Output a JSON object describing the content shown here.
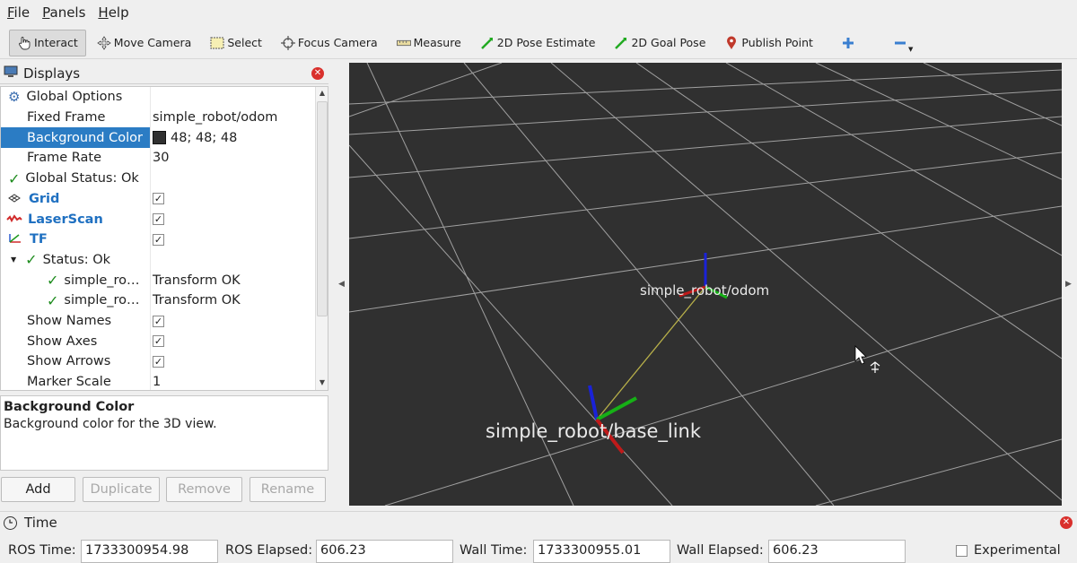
{
  "menu": [
    {
      "key": "F",
      "rest": "ile"
    },
    {
      "key": "P",
      "rest": "anels"
    },
    {
      "key": "H",
      "rest": "elp"
    }
  ],
  "toolbar": {
    "interact": "Interact",
    "move_camera": "Move Camera",
    "select": "Select",
    "focus_camera": "Focus Camera",
    "measure": "Measure",
    "pose_estimate": "2D Pose Estimate",
    "goal_pose": "2D Goal Pose",
    "publish_point": "Publish Point"
  },
  "displays": {
    "title": "Displays",
    "rows": {
      "global_options": "Global Options",
      "fixed_frame": {
        "label": "Fixed Frame",
        "value": "simple_robot/odom"
      },
      "background_color": {
        "label": "Background Color",
        "value": "48; 48; 48",
        "swatch": "#303030"
      },
      "frame_rate": {
        "label": "Frame Rate",
        "value": "30"
      },
      "global_status": "Global Status: Ok",
      "grid": "Grid",
      "laserscan": "LaserScan",
      "tf": "TF",
      "status_ok": "Status: Ok",
      "frame1": {
        "label": "simple_ro…",
        "value": "Transform OK"
      },
      "frame2": {
        "label": "simple_ro…",
        "value": "Transform OK"
      },
      "show_names": "Show Names",
      "show_axes": "Show Axes",
      "show_arrows": "Show Arrows",
      "marker_scale": {
        "label": "Marker Scale",
        "value": "1"
      }
    },
    "description": {
      "title": "Background Color",
      "text": "Background color for the 3D view."
    },
    "buttons": {
      "add": "Add",
      "duplicate": "Duplicate",
      "remove": "Remove",
      "rename": "Rename"
    }
  },
  "view": {
    "label_odom": "simple_robot/odom",
    "label_base": "simple_robot/base_link",
    "background": "#303030"
  },
  "time": {
    "title": "Time",
    "ros_time_label": "ROS Time:",
    "ros_time": "1733300954.98",
    "ros_elapsed_label": "ROS Elapsed:",
    "ros_elapsed": "606.23",
    "wall_time_label": "Wall Time:",
    "wall_time": "1733300955.01",
    "wall_elapsed_label": "Wall Elapsed:",
    "wall_elapsed": "606.23",
    "experimental": "Experimental"
  }
}
